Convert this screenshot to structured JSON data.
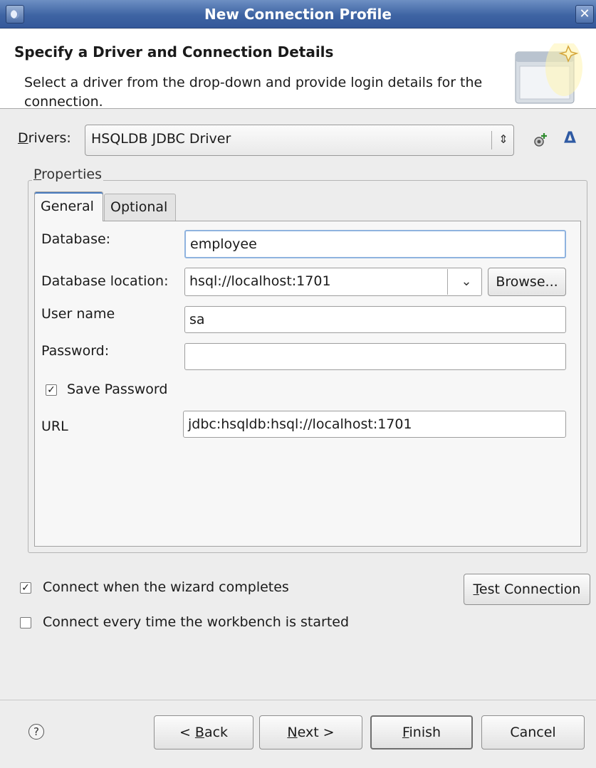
{
  "window": {
    "title": "New Connection Profile",
    "close_glyph": "✕"
  },
  "header": {
    "title": "Specify a Driver and Connection Details",
    "description": "Select a driver from the drop-down and provide login details for the connection."
  },
  "drivers": {
    "label_mnemonic": "D",
    "label_rest": "rivers:",
    "value": "HSQLDB JDBC Driver",
    "arrow_glyph": "⇕",
    "edit_glyph": "Δ"
  },
  "properties": {
    "label_mnemonic": "P",
    "label_rest": "roperties",
    "tabs": [
      {
        "label": "General",
        "selected": true
      },
      {
        "label": "Optional",
        "selected": false
      }
    ],
    "fields": {
      "database_label": "Database:",
      "database_value": "employee",
      "location_label": "Database location:",
      "location_value": "hsql://localhost:1701",
      "location_arrow": "⌄",
      "browse_label": "Browse...",
      "username_label": "User name",
      "username_value": "sa",
      "password_label": "Password:",
      "password_value": "",
      "save_password_label": "Save Password",
      "save_password_checked": true,
      "url_label": "URL",
      "url_value": "jdbc:hsqldb:hsql://localhost:1701"
    }
  },
  "options": {
    "connect_wizard_label": "Connect when the wizard completes",
    "connect_wizard_checked": true,
    "connect_every_label": "Connect every time the workbench is started",
    "connect_every_checked": false,
    "test_mnemonic": "T",
    "test_rest": "est Connection"
  },
  "footer": {
    "help_glyph": "?",
    "back_prefix": "< ",
    "back_mnemonic": "B",
    "back_rest": "ack",
    "next_mnemonic": "N",
    "next_rest": "ext >",
    "finish_mnemonic": "F",
    "finish_rest": "inish",
    "cancel_label": "Cancel"
  },
  "checkmark_glyph": "✓",
  "colors": {
    "titlebar": "#3e64a3",
    "accent": "#4a7cc0",
    "background": "#ededed"
  }
}
